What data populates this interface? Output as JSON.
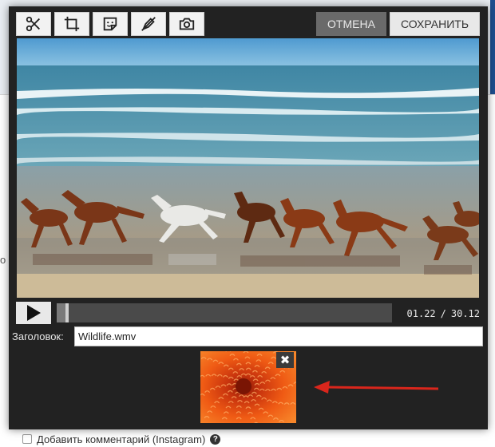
{
  "toolbar": {
    "tools": [
      {
        "name": "scissors-icon"
      },
      {
        "name": "crop-icon"
      },
      {
        "name": "sticker-icon"
      },
      {
        "name": "no-draw-icon"
      },
      {
        "name": "camera-icon"
      }
    ],
    "cancel_label": "ОТМЕНА",
    "save_label": "СОХРАНИТЬ"
  },
  "player": {
    "current_time": "01.22",
    "separator": "/",
    "total_time": "30.12",
    "progress": 0.027
  },
  "title_field": {
    "label": "Заголовок:",
    "value": "Wildlife.wmv"
  },
  "background": {
    "left_fragment": "o",
    "comment_label": "Добавить комментарий (Instagram)",
    "help_glyph": "?"
  },
  "thumbnail": {
    "close_glyph": "✖"
  },
  "colors": {
    "modal_bg": "#222222",
    "arrow": "#d9261c",
    "sky": "#5a9fd0",
    "sea": "#4c8fa8",
    "flower": "#e04a12"
  }
}
